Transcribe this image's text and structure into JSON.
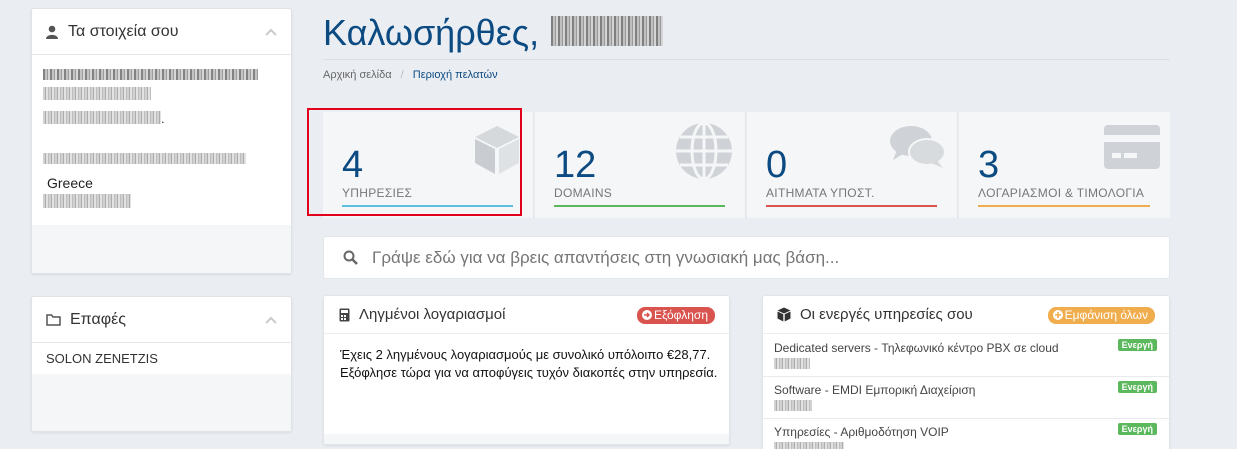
{
  "sidebar": {
    "details": {
      "title": "Τα στοιχεία σου",
      "country": "Greece"
    },
    "contacts": {
      "title": "Επαφές",
      "items": [
        "SOLON ZENETZIS"
      ]
    }
  },
  "header": {
    "welcome": "Καλωσήρθες,",
    "breadcrumb": {
      "home": "Αρχική σελίδα",
      "separator": "/",
      "current": "Περιοχή πελατών"
    }
  },
  "tiles": [
    {
      "value": "4",
      "label": "ΥΠΗΡΕΣΙΕΣ",
      "color": "#5bc0de",
      "icon": "cube-icon"
    },
    {
      "value": "12",
      "label": "DOMAINS",
      "color": "#5cb85c",
      "icon": "globe-icon"
    },
    {
      "value": "0",
      "label": "ΑΙΤΗΜΑΤΑ ΥΠΟΣΤ.",
      "color": "#d9534f",
      "icon": "comments-icon"
    },
    {
      "value": "3",
      "label": "ΛΟΓΑΡΙΑΣΜΟΙ & ΤΙΜΟΛΟΓΙΑ",
      "color": "#f0ad4e",
      "icon": "credit-card-icon"
    }
  ],
  "search": {
    "placeholder": "Γράψε εδώ για να βρεις απαντήσεις στη γνωσιακή μας βάση..."
  },
  "overdue": {
    "title": "Ληγμένοι λογαριασμοί",
    "pay_label": "Εξόφληση",
    "message": "Έχεις 2 ληγμένους λογαριασμούς με συνολικό υπόλοιπο €28,77. Εξόφλησε τώρα για να αποφύγεις τυχόν διακοπές στην υπηρεσία."
  },
  "services": {
    "title": "Οι ενεργές υπηρεσίες σου",
    "view_all_label": "Εμφάνιση όλων",
    "items": [
      {
        "name": "Dedicated servers - Τηλεφωνικό κέντρο PBX σε cloud",
        "status": "Ενεργή"
      },
      {
        "name": "Software - EMDI Εμπορική Διαχείριση",
        "status": "Ενεργή"
      },
      {
        "name": "Υπηρεσίες - Αριθμοδότηση VOIP",
        "status": "Ενεργή"
      }
    ]
  },
  "colors": {
    "brand_blue": "#0c4a82",
    "highlight_red": "#e3001b",
    "pay_red": "#d9534f",
    "view_all_orange": "#f0ad4e",
    "active_green": "#5cb85c"
  }
}
